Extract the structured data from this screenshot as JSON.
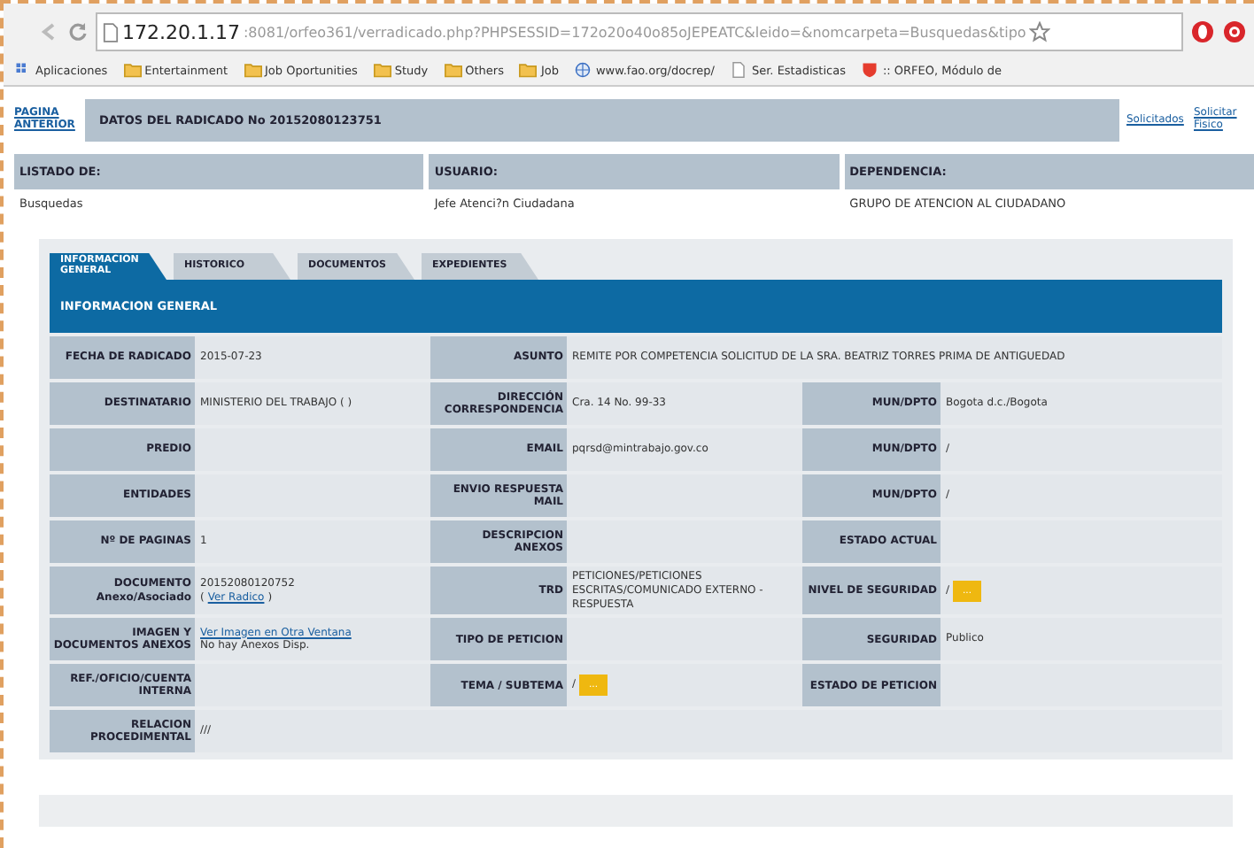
{
  "browser": {
    "address_host": "172.20.1.17",
    "address_path": ":8081/orfeo361/verradicado.php?PHPSESSID=172o20o40o85oJEPEATC&leido=&nomcarpeta=Busquedas&tipo",
    "bookmarks": [
      {
        "kind": "apps",
        "label": "Aplicaciones"
      },
      {
        "kind": "folder",
        "label": "Entertainment"
      },
      {
        "kind": "folder",
        "label": "Job Oportunities"
      },
      {
        "kind": "folder",
        "label": "Study"
      },
      {
        "kind": "folder",
        "label": "Others"
      },
      {
        "kind": "folder",
        "label": "Job"
      },
      {
        "kind": "globe",
        "label": "www.fao.org/docrep/"
      },
      {
        "kind": "page",
        "label": "Ser. Estadisticas"
      },
      {
        "kind": "orfeo",
        "label": ":: ORFEO, Módulo de"
      }
    ]
  },
  "header": {
    "back_link": "PAGINA ANTERIOR",
    "title": "DATOS DEL RADICADO No 20152080123751",
    "links": [
      "Solicitados",
      "Solicitar Fisico"
    ]
  },
  "listing": {
    "columns": [
      {
        "heading": "LISTADO DE:",
        "value": "Busquedas"
      },
      {
        "heading": "USUARIO:",
        "value": "Jefe Atenci?n Ciudadana"
      },
      {
        "heading": "DEPENDENCIA:",
        "value": "GRUPO DE ATENCION AL CIUDADANO"
      }
    ]
  },
  "tabs": [
    {
      "label": "INFORMACION GENERAL",
      "selected": true
    },
    {
      "label": "HISTORICO",
      "selected": false
    },
    {
      "label": "DOCUMENTOS",
      "selected": false
    },
    {
      "label": "EXPEDIENTES",
      "selected": false
    }
  ],
  "section_title": "INFORMACION GENERAL",
  "rows": [
    [
      {
        "kind": "label",
        "text": "FECHA DE RADICADO"
      },
      {
        "kind": "value",
        "lines": [
          [
            {
              "kind": "text",
              "text": "2015-07-23"
            }
          ]
        ]
      },
      {
        "kind": "label",
        "text": "ASUNTO"
      },
      {
        "kind": "wide",
        "lines": [
          [
            {
              "kind": "text",
              "text": "REMITE POR COMPETENCIA SOLICITUD DE LA SRA. BEATRIZ TORRES PRIMA DE ANTIGUEDAD"
            }
          ]
        ]
      }
    ],
    [
      {
        "kind": "label",
        "text": "DESTINATARIO"
      },
      {
        "kind": "value",
        "lines": [
          [
            {
              "kind": "text",
              "text": "MINISTERIO DEL TRABAJO ( )"
            }
          ]
        ]
      },
      {
        "kind": "label",
        "text": "DIRECCIÓN CORRESPONDENCIA"
      },
      {
        "kind": "value",
        "lines": [
          [
            {
              "kind": "text",
              "text": "Cra. 14 No. 99-33"
            }
          ]
        ]
      },
      {
        "kind": "label",
        "text": "MUN/DPTO"
      },
      {
        "kind": "value",
        "lines": [
          [
            {
              "kind": "text",
              "text": "Bogota d.c./Bogota"
            }
          ]
        ]
      }
    ],
    [
      {
        "kind": "label",
        "text": "PREDIO"
      },
      {
        "kind": "value"
      },
      {
        "kind": "label",
        "text": "EMAIL"
      },
      {
        "kind": "value",
        "lines": [
          [
            {
              "kind": "text",
              "text": "pqrsd@mintrabajo.gov.co"
            }
          ]
        ]
      },
      {
        "kind": "label",
        "text": "MUN/DPTO"
      },
      {
        "kind": "value",
        "lines": [
          [
            {
              "kind": "text",
              "text": "/"
            }
          ]
        ]
      }
    ],
    [
      {
        "kind": "label",
        "text": "ENTIDADES"
      },
      {
        "kind": "value"
      },
      {
        "kind": "label",
        "text": "ENVIO RESPUESTA MAIL"
      },
      {
        "kind": "value"
      },
      {
        "kind": "label",
        "text": "MUN/DPTO"
      },
      {
        "kind": "value",
        "lines": [
          [
            {
              "kind": "text",
              "text": "/"
            }
          ]
        ]
      }
    ],
    [
      {
        "kind": "label",
        "text": "Nº DE PAGINAS"
      },
      {
        "kind": "value",
        "lines": [
          [
            {
              "kind": "text",
              "text": "1"
            }
          ]
        ]
      },
      {
        "kind": "label",
        "text": "DESCRIPCION ANEXOS"
      },
      {
        "kind": "value"
      },
      {
        "kind": "label",
        "text": "ESTADO ACTUAL"
      },
      {
        "kind": "value"
      }
    ],
    [
      {
        "kind": "label",
        "text": "DOCUMENTO Anexo/Asociado"
      },
      {
        "kind": "value",
        "lines": [
          [
            {
              "kind": "text",
              "text": "20152080120752"
            }
          ],
          [
            {
              "kind": "text",
              "text": "("
            },
            {
              "kind": "link",
              "text": "Ver Radico"
            },
            {
              "kind": "text",
              "text": ")"
            }
          ]
        ]
      },
      {
        "kind": "label",
        "text": "TRD"
      },
      {
        "kind": "value",
        "lines": [
          [
            {
              "kind": "text",
              "text": "PETICIONES/PETICIONES ESCRITAS/COMUNICADO EXTERNO - RESPUESTA"
            }
          ]
        ]
      },
      {
        "kind": "label",
        "text": "NIVEL DE SEGURIDAD"
      },
      {
        "kind": "value",
        "lines": [
          [
            {
              "kind": "text",
              "text": "/"
            },
            {
              "kind": "button",
              "text": "..."
            }
          ]
        ]
      }
    ],
    [
      {
        "kind": "label",
        "text": "IMAGEN Y DOCUMENTOS ANEXOS"
      },
      {
        "kind": "value",
        "lines": [
          [
            {
              "kind": "link",
              "text": "Ver Imagen en Otra Ventana"
            }
          ],
          [
            {
              "kind": "text",
              "text": "No hay Anexos Disp."
            }
          ]
        ]
      },
      {
        "kind": "label",
        "text": "TIPO DE PETICION"
      },
      {
        "kind": "value"
      },
      {
        "kind": "label",
        "text": "SEGURIDAD"
      },
      {
        "kind": "value",
        "lines": [
          [
            {
              "kind": "text",
              "text": "Publico"
            }
          ]
        ]
      }
    ],
    [
      {
        "kind": "label",
        "text": "REF./OFICIO/CUENTA INTERNA"
      },
      {
        "kind": "value"
      },
      {
        "kind": "label",
        "text": "TEMA / SUBTEMA"
      },
      {
        "kind": "value",
        "lines": [
          [
            {
              "kind": "text",
              "text": "/"
            },
            {
              "kind": "button",
              "text": "..."
            }
          ]
        ]
      },
      {
        "kind": "label",
        "text": "ESTADO DE PETICION"
      },
      {
        "kind": "value"
      }
    ],
    [
      {
        "kind": "label",
        "text": "RELACION PROCEDIMENTAL"
      },
      {
        "kind": "full",
        "lines": [
          [
            {
              "kind": "text",
              "text": "///"
            }
          ]
        ]
      }
    ]
  ]
}
